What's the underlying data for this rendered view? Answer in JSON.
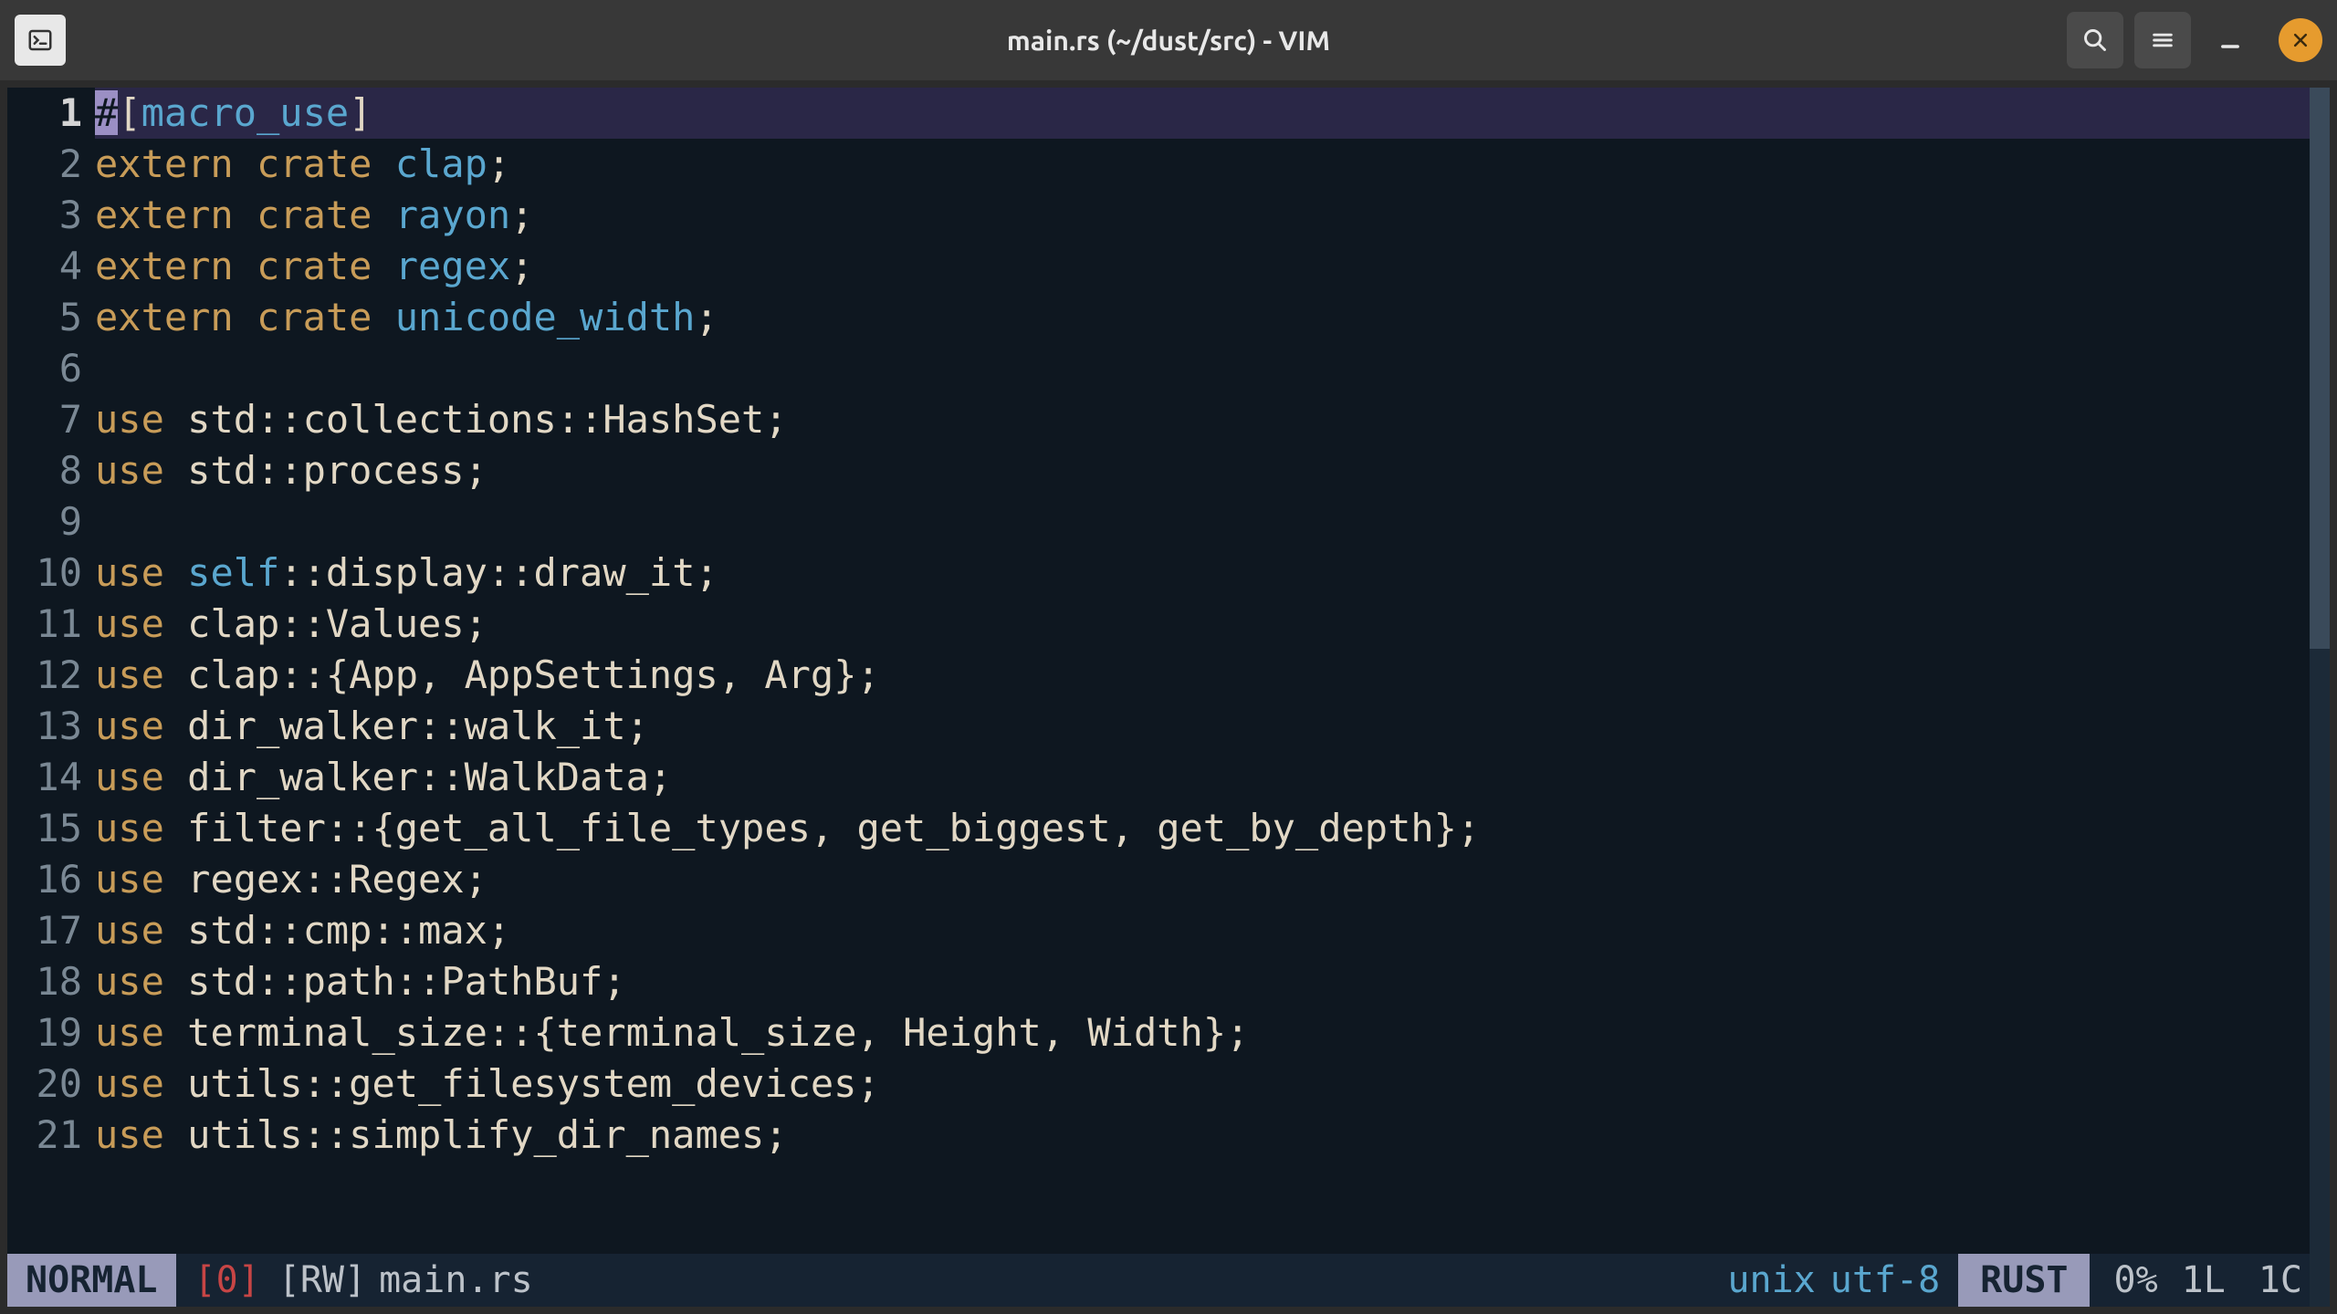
{
  "window": {
    "title": "main.rs (~/dust/src) - VIM"
  },
  "lines": [
    {
      "n": 1,
      "cursorLine": true,
      "tokens": [
        {
          "t": "#",
          "c": "c-attr cursor-block"
        },
        {
          "t": "[",
          "c": "c-punc"
        },
        {
          "t": "macro_use",
          "c": "c-ty"
        },
        {
          "t": "]",
          "c": "c-punc"
        }
      ]
    },
    {
      "n": 2,
      "tokens": [
        {
          "t": "extern",
          "c": "c-kw"
        },
        {
          "t": " "
        },
        {
          "t": "crate",
          "c": "c-kw"
        },
        {
          "t": " "
        },
        {
          "t": "clap",
          "c": "c-ty"
        },
        {
          "t": ";",
          "c": "c-punc"
        }
      ]
    },
    {
      "n": 3,
      "tokens": [
        {
          "t": "extern",
          "c": "c-kw"
        },
        {
          "t": " "
        },
        {
          "t": "crate",
          "c": "c-kw"
        },
        {
          "t": " "
        },
        {
          "t": "rayon",
          "c": "c-ty"
        },
        {
          "t": ";",
          "c": "c-punc"
        }
      ]
    },
    {
      "n": 4,
      "tokens": [
        {
          "t": "extern",
          "c": "c-kw"
        },
        {
          "t": " "
        },
        {
          "t": "crate",
          "c": "c-kw"
        },
        {
          "t": " "
        },
        {
          "t": "regex",
          "c": "c-ty"
        },
        {
          "t": ";",
          "c": "c-punc"
        }
      ]
    },
    {
      "n": 5,
      "tokens": [
        {
          "t": "extern",
          "c": "c-kw"
        },
        {
          "t": " "
        },
        {
          "t": "crate",
          "c": "c-kw"
        },
        {
          "t": " "
        },
        {
          "t": "unicode_width",
          "c": "c-ty"
        },
        {
          "t": ";",
          "c": "c-punc"
        }
      ]
    },
    {
      "n": 6,
      "tokens": []
    },
    {
      "n": 7,
      "tokens": [
        {
          "t": "use",
          "c": "c-kw"
        },
        {
          "t": " "
        },
        {
          "t": "std",
          "c": "c-id"
        },
        {
          "t": "::",
          "c": "c-op"
        },
        {
          "t": "collections",
          "c": "c-id"
        },
        {
          "t": "::",
          "c": "c-op"
        },
        {
          "t": "HashSet",
          "c": "c-id"
        },
        {
          "t": ";",
          "c": "c-punc"
        }
      ]
    },
    {
      "n": 8,
      "tokens": [
        {
          "t": "use",
          "c": "c-kw"
        },
        {
          "t": " "
        },
        {
          "t": "std",
          "c": "c-id"
        },
        {
          "t": "::",
          "c": "c-op"
        },
        {
          "t": "process",
          "c": "c-id"
        },
        {
          "t": ";",
          "c": "c-punc"
        }
      ]
    },
    {
      "n": 9,
      "tokens": []
    },
    {
      "n": 10,
      "tokens": [
        {
          "t": "use",
          "c": "c-kw"
        },
        {
          "t": " "
        },
        {
          "t": "self",
          "c": "c-ty"
        },
        {
          "t": "::",
          "c": "c-op"
        },
        {
          "t": "display",
          "c": "c-id"
        },
        {
          "t": "::",
          "c": "c-op"
        },
        {
          "t": "draw_it",
          "c": "c-id"
        },
        {
          "t": ";",
          "c": "c-punc"
        }
      ]
    },
    {
      "n": 11,
      "tokens": [
        {
          "t": "use",
          "c": "c-kw"
        },
        {
          "t": " "
        },
        {
          "t": "clap",
          "c": "c-id"
        },
        {
          "t": "::",
          "c": "c-op"
        },
        {
          "t": "Values",
          "c": "c-id"
        },
        {
          "t": ";",
          "c": "c-punc"
        }
      ]
    },
    {
      "n": 12,
      "tokens": [
        {
          "t": "use",
          "c": "c-kw"
        },
        {
          "t": " "
        },
        {
          "t": "clap",
          "c": "c-id"
        },
        {
          "t": "::",
          "c": "c-op"
        },
        {
          "t": "{",
          "c": "c-punc"
        },
        {
          "t": "App",
          "c": "c-id"
        },
        {
          "t": ", ",
          "c": "c-punc"
        },
        {
          "t": "AppSettings",
          "c": "c-id"
        },
        {
          "t": ", ",
          "c": "c-punc"
        },
        {
          "t": "Arg",
          "c": "c-id"
        },
        {
          "t": "}",
          "c": "c-punc"
        },
        {
          "t": ";",
          "c": "c-punc"
        }
      ]
    },
    {
      "n": 13,
      "tokens": [
        {
          "t": "use",
          "c": "c-kw"
        },
        {
          "t": " "
        },
        {
          "t": "dir_walker",
          "c": "c-id"
        },
        {
          "t": "::",
          "c": "c-op"
        },
        {
          "t": "walk_it",
          "c": "c-id"
        },
        {
          "t": ";",
          "c": "c-punc"
        }
      ]
    },
    {
      "n": 14,
      "tokens": [
        {
          "t": "use",
          "c": "c-kw"
        },
        {
          "t": " "
        },
        {
          "t": "dir_walker",
          "c": "c-id"
        },
        {
          "t": "::",
          "c": "c-op"
        },
        {
          "t": "WalkData",
          "c": "c-id"
        },
        {
          "t": ";",
          "c": "c-punc"
        }
      ]
    },
    {
      "n": 15,
      "tokens": [
        {
          "t": "use",
          "c": "c-kw"
        },
        {
          "t": " "
        },
        {
          "t": "filter",
          "c": "c-id"
        },
        {
          "t": "::",
          "c": "c-op"
        },
        {
          "t": "{",
          "c": "c-punc"
        },
        {
          "t": "get_all_file_types",
          "c": "c-id"
        },
        {
          "t": ", ",
          "c": "c-punc"
        },
        {
          "t": "get_biggest",
          "c": "c-id"
        },
        {
          "t": ", ",
          "c": "c-punc"
        },
        {
          "t": "get_by_depth",
          "c": "c-id"
        },
        {
          "t": "}",
          "c": "c-punc"
        },
        {
          "t": ";",
          "c": "c-punc"
        }
      ]
    },
    {
      "n": 16,
      "tokens": [
        {
          "t": "use",
          "c": "c-kw"
        },
        {
          "t": " "
        },
        {
          "t": "regex",
          "c": "c-id"
        },
        {
          "t": "::",
          "c": "c-op"
        },
        {
          "t": "Regex",
          "c": "c-id"
        },
        {
          "t": ";",
          "c": "c-punc"
        }
      ]
    },
    {
      "n": 17,
      "tokens": [
        {
          "t": "use",
          "c": "c-kw"
        },
        {
          "t": " "
        },
        {
          "t": "std",
          "c": "c-id"
        },
        {
          "t": "::",
          "c": "c-op"
        },
        {
          "t": "cmp",
          "c": "c-id"
        },
        {
          "t": "::",
          "c": "c-op"
        },
        {
          "t": "max",
          "c": "c-id"
        },
        {
          "t": ";",
          "c": "c-punc"
        }
      ]
    },
    {
      "n": 18,
      "tokens": [
        {
          "t": "use",
          "c": "c-kw"
        },
        {
          "t": " "
        },
        {
          "t": "std",
          "c": "c-id"
        },
        {
          "t": "::",
          "c": "c-op"
        },
        {
          "t": "path",
          "c": "c-id"
        },
        {
          "t": "::",
          "c": "c-op"
        },
        {
          "t": "PathBuf",
          "c": "c-id"
        },
        {
          "t": ";",
          "c": "c-punc"
        }
      ]
    },
    {
      "n": 19,
      "tokens": [
        {
          "t": "use",
          "c": "c-kw"
        },
        {
          "t": " "
        },
        {
          "t": "terminal_size",
          "c": "c-id"
        },
        {
          "t": "::",
          "c": "c-op"
        },
        {
          "t": "{",
          "c": "c-punc"
        },
        {
          "t": "terminal_size",
          "c": "c-id"
        },
        {
          "t": ", ",
          "c": "c-punc"
        },
        {
          "t": "Height",
          "c": "c-id"
        },
        {
          "t": ", ",
          "c": "c-punc"
        },
        {
          "t": "Width",
          "c": "c-id"
        },
        {
          "t": "}",
          "c": "c-punc"
        },
        {
          "t": ";",
          "c": "c-punc"
        }
      ]
    },
    {
      "n": 20,
      "tokens": [
        {
          "t": "use",
          "c": "c-kw"
        },
        {
          "t": " "
        },
        {
          "t": "utils",
          "c": "c-id"
        },
        {
          "t": "::",
          "c": "c-op"
        },
        {
          "t": "get_filesystem_devices",
          "c": "c-id"
        },
        {
          "t": ";",
          "c": "c-punc"
        }
      ]
    },
    {
      "n": 21,
      "tokens": [
        {
          "t": "use",
          "c": "c-kw"
        },
        {
          "t": " "
        },
        {
          "t": "utils",
          "c": "c-id"
        },
        {
          "t": "::",
          "c": "c-op"
        },
        {
          "t": "simplify_dir_names",
          "c": "c-id"
        },
        {
          "t": ";",
          "c": "c-punc"
        }
      ]
    }
  ],
  "status": {
    "mode": " NORMAL ",
    "zero": "[0]",
    "rw": "[RW]",
    "file": "main.rs",
    "ff": "unix",
    "enc": "utf-8",
    "lang": " RUST ",
    "pct": "0%",
    "line": "1L",
    "col": "1C"
  }
}
